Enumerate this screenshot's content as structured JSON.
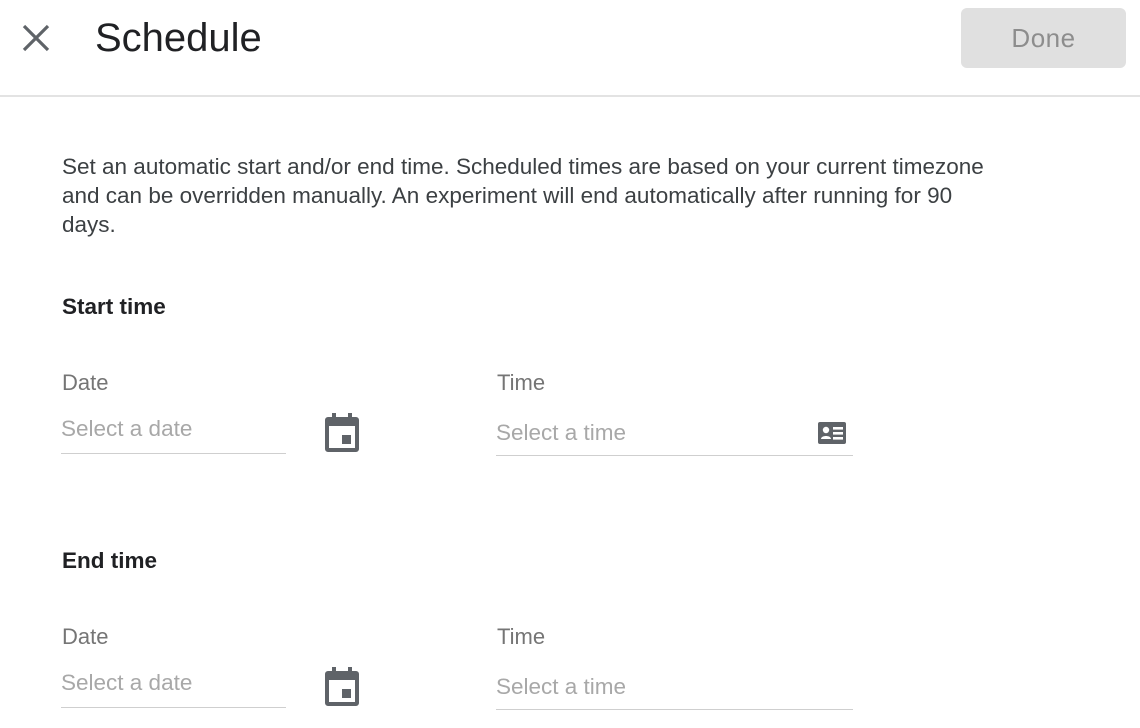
{
  "header": {
    "title": "Schedule",
    "close_icon": "close-icon",
    "done_label": "Done"
  },
  "description": "Set an automatic start and/or end time. Scheduled times are based on your current timezone and can be overridden manually. An experiment will end automatically after running for 90 days.",
  "start": {
    "heading": "Start time",
    "date_label": "Date",
    "date_placeholder": "Select a date",
    "date_icon": "calendar-icon",
    "time_label": "Time",
    "time_placeholder": "Select a time",
    "time_icon": "contact-card-icon"
  },
  "end": {
    "heading": "End time",
    "date_label": "Date",
    "date_placeholder": "Select a date",
    "date_icon": "calendar-icon",
    "time_label": "Time",
    "time_placeholder": "Select a time"
  },
  "colors": {
    "text": "#202124",
    "secondary_text": "#757575",
    "placeholder": "#a8a8a8",
    "icon": "#5f6368",
    "done_bg": "#e0e0e0",
    "done_text": "#8d8d8d"
  }
}
